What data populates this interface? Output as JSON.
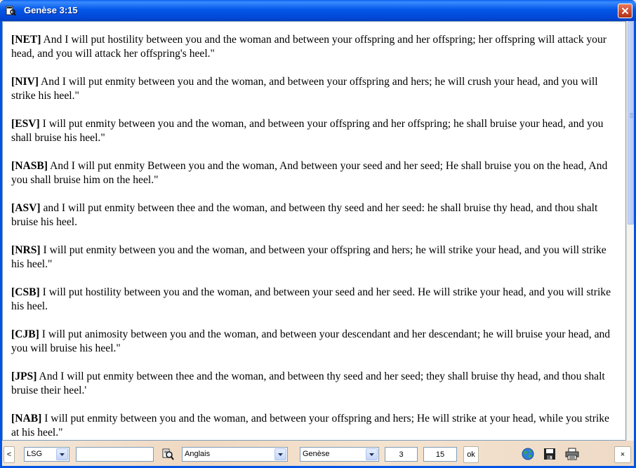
{
  "window": {
    "title": "Genèse 3:15"
  },
  "verses": [
    {
      "tag": "[NET]",
      "text": " And I will put hostility between you and the woman and between your offspring and her offspring; her offspring will attack your head, and you will attack her offspring's heel.\""
    },
    {
      "tag": "[NIV]",
      "text": " And I will put enmity between you and the woman, and between your offspring and hers; he will crush your head, and you will strike his heel.\""
    },
    {
      "tag": "[ESV]",
      "text": " I will put enmity between you and the woman, and between your offspring and her offspring; he shall bruise your head, and you shall bruise his heel.\""
    },
    {
      "tag": "[NASB]",
      "text": " And I will put enmity Between you and the woman, And between your seed and her seed; He shall bruise you on the head, And you shall bruise him on the heel.\""
    },
    {
      "tag": "[ASV]",
      "text": " and I will put enmity between thee and the woman, and between thy seed and her seed: he shall bruise thy head, and thou shalt bruise his heel."
    },
    {
      "tag": "[NRS]",
      "text": " I will put enmity between you and the woman, and between your offspring and hers; he will strike your head, and you will strike his heel.\""
    },
    {
      "tag": "[CSB]",
      "text": " I will put hostility between you and the woman, and between your seed and her seed. He will strike your head, and you will strike his heel."
    },
    {
      "tag": "[CJB]",
      "text": " I will put animosity between you and the woman, and between your descendant and her descendant; he will bruise your head, and you will bruise his heel.\""
    },
    {
      "tag": "[JPS]",
      "text": " And I will put enmity between thee and the woman, and between thy seed and her seed; they shall bruise thy head, and thou shalt bruise their heel.'"
    },
    {
      "tag": "[NAB]",
      "text": " I will put enmity between you and the woman, and between your offspring and hers; He will strike at your head, while you strike at his heel.\""
    }
  ],
  "toolbar": {
    "prev_label": "<",
    "version": "LSG",
    "search_value": "",
    "language": "Anglais",
    "book": "Genèse",
    "chapter": "3",
    "verse": "15",
    "ok_label": "ok",
    "close_label": "×"
  },
  "icons": {
    "app": "bible-search-icon",
    "search": "magnifier-icon",
    "web": "globe-icon",
    "save": "floppy-disk-icon",
    "print": "printer-icon"
  }
}
